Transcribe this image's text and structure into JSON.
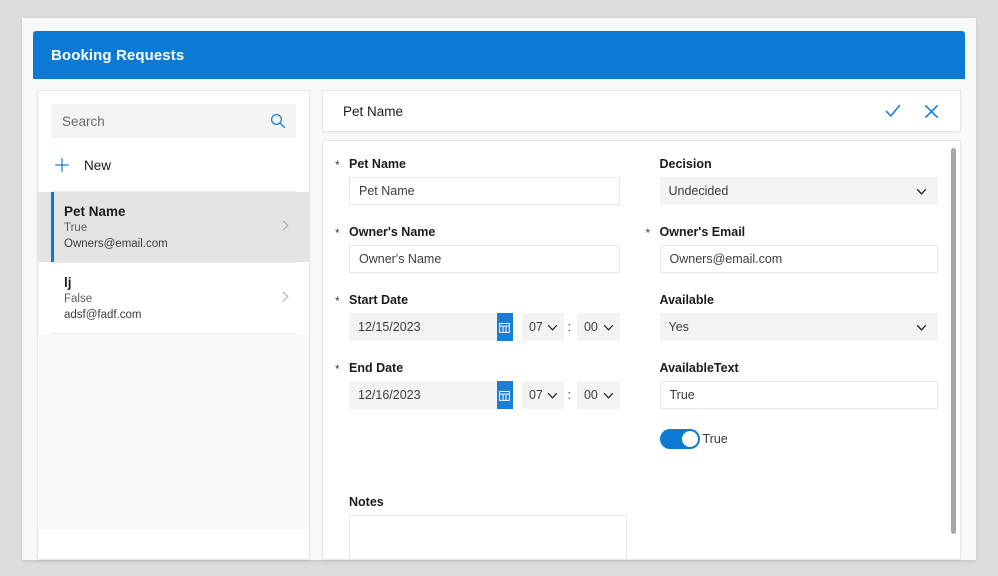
{
  "window": {
    "title": "Booking Requests",
    "accent_color": "#0b7ad4",
    "page_background": "#dcdcdc"
  },
  "sidebar": {
    "search": {
      "placeholder": "Search",
      "value": "",
      "icon": "search-icon"
    },
    "new_button": {
      "label": "New",
      "icon": "plus-icon"
    },
    "items": [
      {
        "title": "Pet Name",
        "sub1": "True",
        "sub2": "Owners@email.com",
        "selected": true,
        "chevron": "chevron-right-icon"
      },
      {
        "title": "lj",
        "sub1": "False",
        "sub2": "adsf@fadf.com",
        "selected": false,
        "chevron": "chevron-right-icon"
      }
    ]
  },
  "form_header": {
    "title": "Pet Name",
    "confirm_icon": "checkmark-icon",
    "cancel_icon": "close-icon"
  },
  "form": {
    "left_column": [
      {
        "type": "text",
        "label": "Pet Name",
        "required": true,
        "required_marker": "*",
        "value": "Pet Name"
      },
      {
        "type": "text",
        "label": "Owner's Name",
        "required": true,
        "required_marker": "*",
        "value": "Owner's Name"
      },
      {
        "type": "datetime",
        "label": "Start Date",
        "required": true,
        "required_marker": "*",
        "date": "12/15/2023",
        "hour": "07",
        "minute": "00",
        "separator": ":",
        "calendar_icon": "calendar-icon"
      },
      {
        "type": "datetime",
        "label": "End Date",
        "required": true,
        "required_marker": "*",
        "date": "12/16/2023",
        "hour": "07",
        "minute": "00",
        "separator": ":",
        "calendar_icon": "calendar-icon"
      }
    ],
    "right_column": [
      {
        "type": "select",
        "label": "Decision",
        "required": false,
        "required_marker": "",
        "value": "Undecided"
      },
      {
        "type": "text",
        "label": "Owner's Email",
        "required": true,
        "required_marker": "*",
        "value": "Owners@email.com"
      },
      {
        "type": "select",
        "label": "Available",
        "required": false,
        "required_marker": "",
        "value": "Yes"
      },
      {
        "type": "text",
        "label": "AvailableText",
        "required": false,
        "required_marker": "",
        "value": "True"
      }
    ],
    "toggle": {
      "label": "True",
      "state": "on"
    },
    "notes": {
      "label": "Notes",
      "value": "",
      "placeholder": ""
    }
  }
}
